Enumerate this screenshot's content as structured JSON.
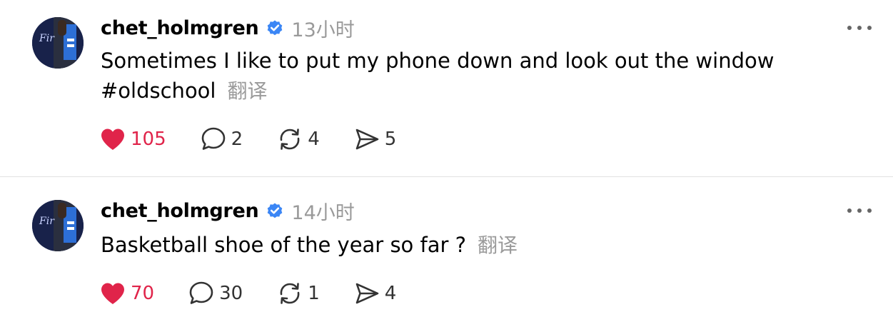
{
  "colors": {
    "like_active": "#e0244a",
    "verified_badge": "#3b86f5",
    "muted_text": "#9a9a9a",
    "divider": "#e2e2e2"
  },
  "icons": {
    "like": "heart-filled-icon",
    "reply": "speech-bubble-icon",
    "repost": "repost-arrows-icon",
    "share": "send-arrow-icon",
    "more": "ellipsis-icon",
    "verified": "verified-badge-icon"
  },
  "posts": [
    {
      "username": "chet_holmgren",
      "timestamp": "13小时",
      "text": "Sometimes I like to put my phone down and look out the window\n#oldschool",
      "translate_label": "翻译",
      "likes": "105",
      "liked": true,
      "replies": "2",
      "reposts": "4",
      "shares": "5"
    },
    {
      "username": "chet_holmgren",
      "timestamp": "14小时",
      "text": "Basketball shoe of the year so far ?",
      "translate_label": "翻译",
      "likes": "70",
      "liked": true,
      "replies": "30",
      "reposts": "1",
      "shares": "4"
    }
  ]
}
